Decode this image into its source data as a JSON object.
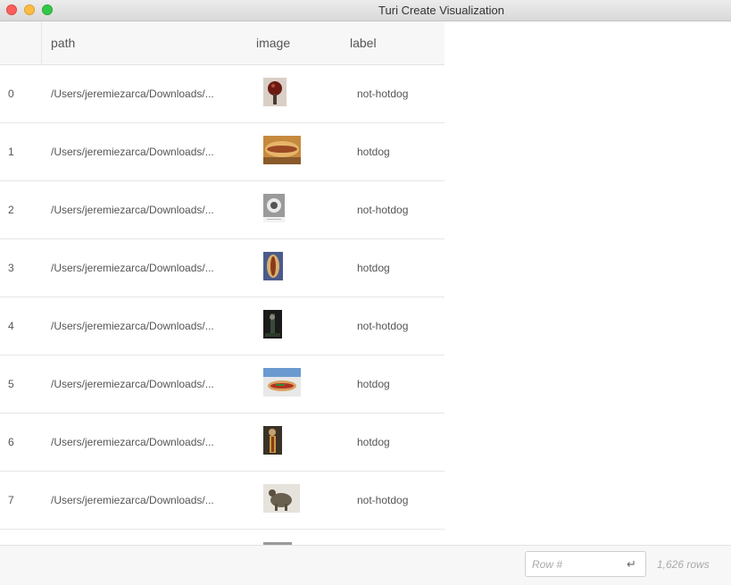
{
  "window": {
    "title": "Turi Create Visualization"
  },
  "columns": [
    "path",
    "image",
    "label"
  ],
  "rows": [
    {
      "index": "0",
      "path": "/Users/jeremiezarca/Downloads/...",
      "label": "not-hotdog",
      "image": "image-thumbnail"
    },
    {
      "index": "1",
      "path": "/Users/jeremiezarca/Downloads/...",
      "label": "hotdog",
      "image": "image-thumbnail"
    },
    {
      "index": "2",
      "path": "/Users/jeremiezarca/Downloads/...",
      "label": "not-hotdog",
      "image": "image-thumbnail"
    },
    {
      "index": "3",
      "path": "/Users/jeremiezarca/Downloads/...",
      "label": "hotdog",
      "image": "image-thumbnail"
    },
    {
      "index": "4",
      "path": "/Users/jeremiezarca/Downloads/...",
      "label": "not-hotdog",
      "image": "image-thumbnail"
    },
    {
      "index": "5",
      "path": "/Users/jeremiezarca/Downloads/...",
      "label": "hotdog",
      "image": "image-thumbnail"
    },
    {
      "index": "6",
      "path": "/Users/jeremiezarca/Downloads/...",
      "label": "hotdog",
      "image": "image-thumbnail"
    },
    {
      "index": "7",
      "path": "/Users/jeremiezarca/Downloads/...",
      "label": "not-hotdog",
      "image": "image-thumbnail"
    }
  ],
  "footer": {
    "row_placeholder": "Row #",
    "enter_icon": "return-arrow-icon",
    "enter_glyph": "↵",
    "row_count": "1,626 rows"
  }
}
